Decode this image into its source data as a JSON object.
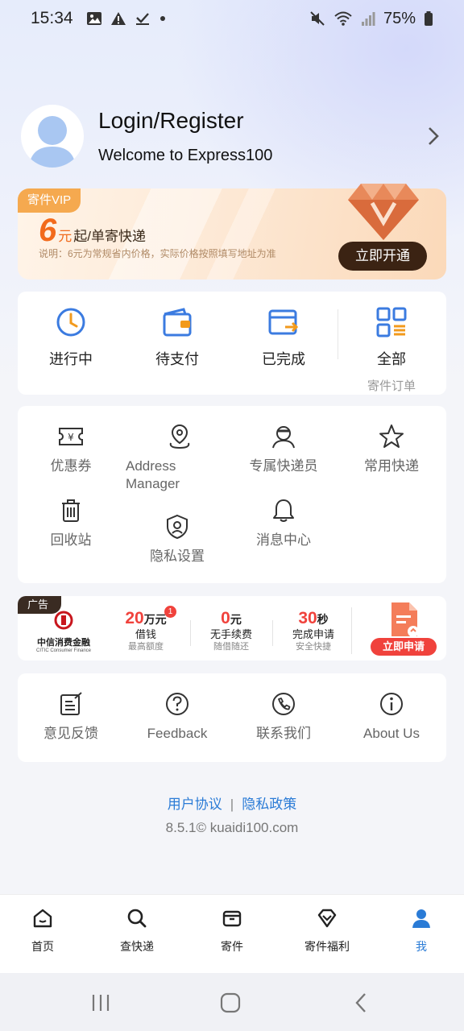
{
  "status_bar": {
    "time": "15:34",
    "battery": "75%",
    "left_icons": [
      "image-icon",
      "alert-icon",
      "task-done-icon",
      "dot-icon"
    ],
    "right_icons": [
      "mute-icon",
      "wifi-icon",
      "signal-icon",
      "battery-icon"
    ]
  },
  "profile": {
    "title": "Login/Register",
    "subtitle": "Welcome to Express100"
  },
  "vip": {
    "tag": "寄件VIP",
    "price": "6",
    "unit": "元",
    "price_tail": "起/单寄快递",
    "note": "说明：6元为常规省内价格，实际价格按照填写地址为准",
    "button": "立即开通"
  },
  "orders": {
    "items": [
      {
        "label": "进行中",
        "icon": "clock-icon"
      },
      {
        "label": "待支付",
        "icon": "wallet-icon"
      },
      {
        "label": "已完成",
        "icon": "box-arrow-icon"
      },
      {
        "label": "全部",
        "icon": "grid-list-icon"
      }
    ],
    "all_sub": "寄件订单"
  },
  "tools": {
    "items": [
      {
        "label": "优惠券",
        "icon": "coupon-icon"
      },
      {
        "label": "Address Manager",
        "label_lines": [
          "Address",
          "Manager"
        ],
        "icon": "location-pin-icon"
      },
      {
        "label": "专属快递员",
        "icon": "courier-icon"
      },
      {
        "label": "常用快递",
        "icon": "star-icon"
      },
      {
        "label": "回收站",
        "icon": "trash-icon"
      },
      {
        "label": "隐私设置",
        "icon": "shield-icon"
      },
      {
        "label": "消息中心",
        "icon": "bell-icon"
      }
    ]
  },
  "ad": {
    "tag": "广告",
    "brand_cn": "中信消费金融",
    "brand_en": "CITIC Consumer Finance",
    "col1": {
      "big": "20",
      "unit": "万元",
      "l2": "借钱",
      "l3": "最高额度",
      "badge": "1"
    },
    "col2": {
      "big": "0",
      "unit": "元",
      "l2": "无手续费",
      "l3": "随借随还"
    },
    "col3": {
      "big": "30",
      "unit": "秒",
      "l2": "完成申请",
      "l3": "安全快捷"
    },
    "button": "立即申请"
  },
  "help": {
    "items": [
      {
        "label": "意见反馈",
        "icon": "edit-note-icon"
      },
      {
        "label": "Feedback",
        "icon": "question-icon"
      },
      {
        "label": "联系我们",
        "icon": "phone-icon"
      },
      {
        "label": "About Us",
        "icon": "info-icon"
      }
    ]
  },
  "footer": {
    "user_agreement": "用户协议",
    "separator": "|",
    "privacy_policy": "隐私政策",
    "version": "8.5.1© kuaidi100.com"
  },
  "bottom_nav": {
    "items": [
      {
        "label": "首页",
        "icon": "home-icon"
      },
      {
        "label": "查快递",
        "icon": "search-icon"
      },
      {
        "label": "寄件",
        "icon": "package-icon"
      },
      {
        "label": "寄件福利",
        "icon": "gift-diamond-icon"
      },
      {
        "label": "我",
        "icon": "person-icon",
        "active": true
      }
    ]
  },
  "colors": {
    "accent_blue": "#2a7bd6",
    "vip_orange": "#f26a1b",
    "ad_red": "#f0423c",
    "vip_button": "#3b2313"
  }
}
